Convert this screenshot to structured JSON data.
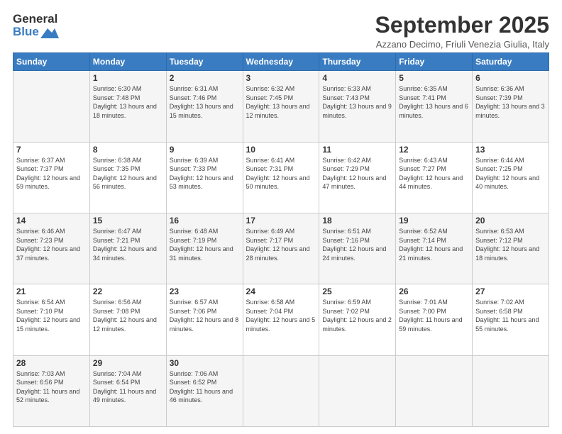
{
  "logo": {
    "line1": "General",
    "line2": "Blue"
  },
  "title": "September 2025",
  "subtitle": "Azzano Decimo, Friuli Venezia Giulia, Italy",
  "days_of_week": [
    "Sunday",
    "Monday",
    "Tuesday",
    "Wednesday",
    "Thursday",
    "Friday",
    "Saturday"
  ],
  "weeks": [
    [
      {
        "day": "",
        "sunrise": "",
        "sunset": "",
        "daylight": ""
      },
      {
        "day": "1",
        "sunrise": "Sunrise: 6:30 AM",
        "sunset": "Sunset: 7:48 PM",
        "daylight": "Daylight: 13 hours and 18 minutes."
      },
      {
        "day": "2",
        "sunrise": "Sunrise: 6:31 AM",
        "sunset": "Sunset: 7:46 PM",
        "daylight": "Daylight: 13 hours and 15 minutes."
      },
      {
        "day": "3",
        "sunrise": "Sunrise: 6:32 AM",
        "sunset": "Sunset: 7:45 PM",
        "daylight": "Daylight: 13 hours and 12 minutes."
      },
      {
        "day": "4",
        "sunrise": "Sunrise: 6:33 AM",
        "sunset": "Sunset: 7:43 PM",
        "daylight": "Daylight: 13 hours and 9 minutes."
      },
      {
        "day": "5",
        "sunrise": "Sunrise: 6:35 AM",
        "sunset": "Sunset: 7:41 PM",
        "daylight": "Daylight: 13 hours and 6 minutes."
      },
      {
        "day": "6",
        "sunrise": "Sunrise: 6:36 AM",
        "sunset": "Sunset: 7:39 PM",
        "daylight": "Daylight: 13 hours and 3 minutes."
      }
    ],
    [
      {
        "day": "7",
        "sunrise": "Sunrise: 6:37 AM",
        "sunset": "Sunset: 7:37 PM",
        "daylight": "Daylight: 12 hours and 59 minutes."
      },
      {
        "day": "8",
        "sunrise": "Sunrise: 6:38 AM",
        "sunset": "Sunset: 7:35 PM",
        "daylight": "Daylight: 12 hours and 56 minutes."
      },
      {
        "day": "9",
        "sunrise": "Sunrise: 6:39 AM",
        "sunset": "Sunset: 7:33 PM",
        "daylight": "Daylight: 12 hours and 53 minutes."
      },
      {
        "day": "10",
        "sunrise": "Sunrise: 6:41 AM",
        "sunset": "Sunset: 7:31 PM",
        "daylight": "Daylight: 12 hours and 50 minutes."
      },
      {
        "day": "11",
        "sunrise": "Sunrise: 6:42 AM",
        "sunset": "Sunset: 7:29 PM",
        "daylight": "Daylight: 12 hours and 47 minutes."
      },
      {
        "day": "12",
        "sunrise": "Sunrise: 6:43 AM",
        "sunset": "Sunset: 7:27 PM",
        "daylight": "Daylight: 12 hours and 44 minutes."
      },
      {
        "day": "13",
        "sunrise": "Sunrise: 6:44 AM",
        "sunset": "Sunset: 7:25 PM",
        "daylight": "Daylight: 12 hours and 40 minutes."
      }
    ],
    [
      {
        "day": "14",
        "sunrise": "Sunrise: 6:46 AM",
        "sunset": "Sunset: 7:23 PM",
        "daylight": "Daylight: 12 hours and 37 minutes."
      },
      {
        "day": "15",
        "sunrise": "Sunrise: 6:47 AM",
        "sunset": "Sunset: 7:21 PM",
        "daylight": "Daylight: 12 hours and 34 minutes."
      },
      {
        "day": "16",
        "sunrise": "Sunrise: 6:48 AM",
        "sunset": "Sunset: 7:19 PM",
        "daylight": "Daylight: 12 hours and 31 minutes."
      },
      {
        "day": "17",
        "sunrise": "Sunrise: 6:49 AM",
        "sunset": "Sunset: 7:17 PM",
        "daylight": "Daylight: 12 hours and 28 minutes."
      },
      {
        "day": "18",
        "sunrise": "Sunrise: 6:51 AM",
        "sunset": "Sunset: 7:16 PM",
        "daylight": "Daylight: 12 hours and 24 minutes."
      },
      {
        "day": "19",
        "sunrise": "Sunrise: 6:52 AM",
        "sunset": "Sunset: 7:14 PM",
        "daylight": "Daylight: 12 hours and 21 minutes."
      },
      {
        "day": "20",
        "sunrise": "Sunrise: 6:53 AM",
        "sunset": "Sunset: 7:12 PM",
        "daylight": "Daylight: 12 hours and 18 minutes."
      }
    ],
    [
      {
        "day": "21",
        "sunrise": "Sunrise: 6:54 AM",
        "sunset": "Sunset: 7:10 PM",
        "daylight": "Daylight: 12 hours and 15 minutes."
      },
      {
        "day": "22",
        "sunrise": "Sunrise: 6:56 AM",
        "sunset": "Sunset: 7:08 PM",
        "daylight": "Daylight: 12 hours and 12 minutes."
      },
      {
        "day": "23",
        "sunrise": "Sunrise: 6:57 AM",
        "sunset": "Sunset: 7:06 PM",
        "daylight": "Daylight: 12 hours and 8 minutes."
      },
      {
        "day": "24",
        "sunrise": "Sunrise: 6:58 AM",
        "sunset": "Sunset: 7:04 PM",
        "daylight": "Daylight: 12 hours and 5 minutes."
      },
      {
        "day": "25",
        "sunrise": "Sunrise: 6:59 AM",
        "sunset": "Sunset: 7:02 PM",
        "daylight": "Daylight: 12 hours and 2 minutes."
      },
      {
        "day": "26",
        "sunrise": "Sunrise: 7:01 AM",
        "sunset": "Sunset: 7:00 PM",
        "daylight": "Daylight: 11 hours and 59 minutes."
      },
      {
        "day": "27",
        "sunrise": "Sunrise: 7:02 AM",
        "sunset": "Sunset: 6:58 PM",
        "daylight": "Daylight: 11 hours and 55 minutes."
      }
    ],
    [
      {
        "day": "28",
        "sunrise": "Sunrise: 7:03 AM",
        "sunset": "Sunset: 6:56 PM",
        "daylight": "Daylight: 11 hours and 52 minutes."
      },
      {
        "day": "29",
        "sunrise": "Sunrise: 7:04 AM",
        "sunset": "Sunset: 6:54 PM",
        "daylight": "Daylight: 11 hours and 49 minutes."
      },
      {
        "day": "30",
        "sunrise": "Sunrise: 7:06 AM",
        "sunset": "Sunset: 6:52 PM",
        "daylight": "Daylight: 11 hours and 46 minutes."
      },
      {
        "day": "",
        "sunrise": "",
        "sunset": "",
        "daylight": ""
      },
      {
        "day": "",
        "sunrise": "",
        "sunset": "",
        "daylight": ""
      },
      {
        "day": "",
        "sunrise": "",
        "sunset": "",
        "daylight": ""
      },
      {
        "day": "",
        "sunrise": "",
        "sunset": "",
        "daylight": ""
      }
    ]
  ]
}
